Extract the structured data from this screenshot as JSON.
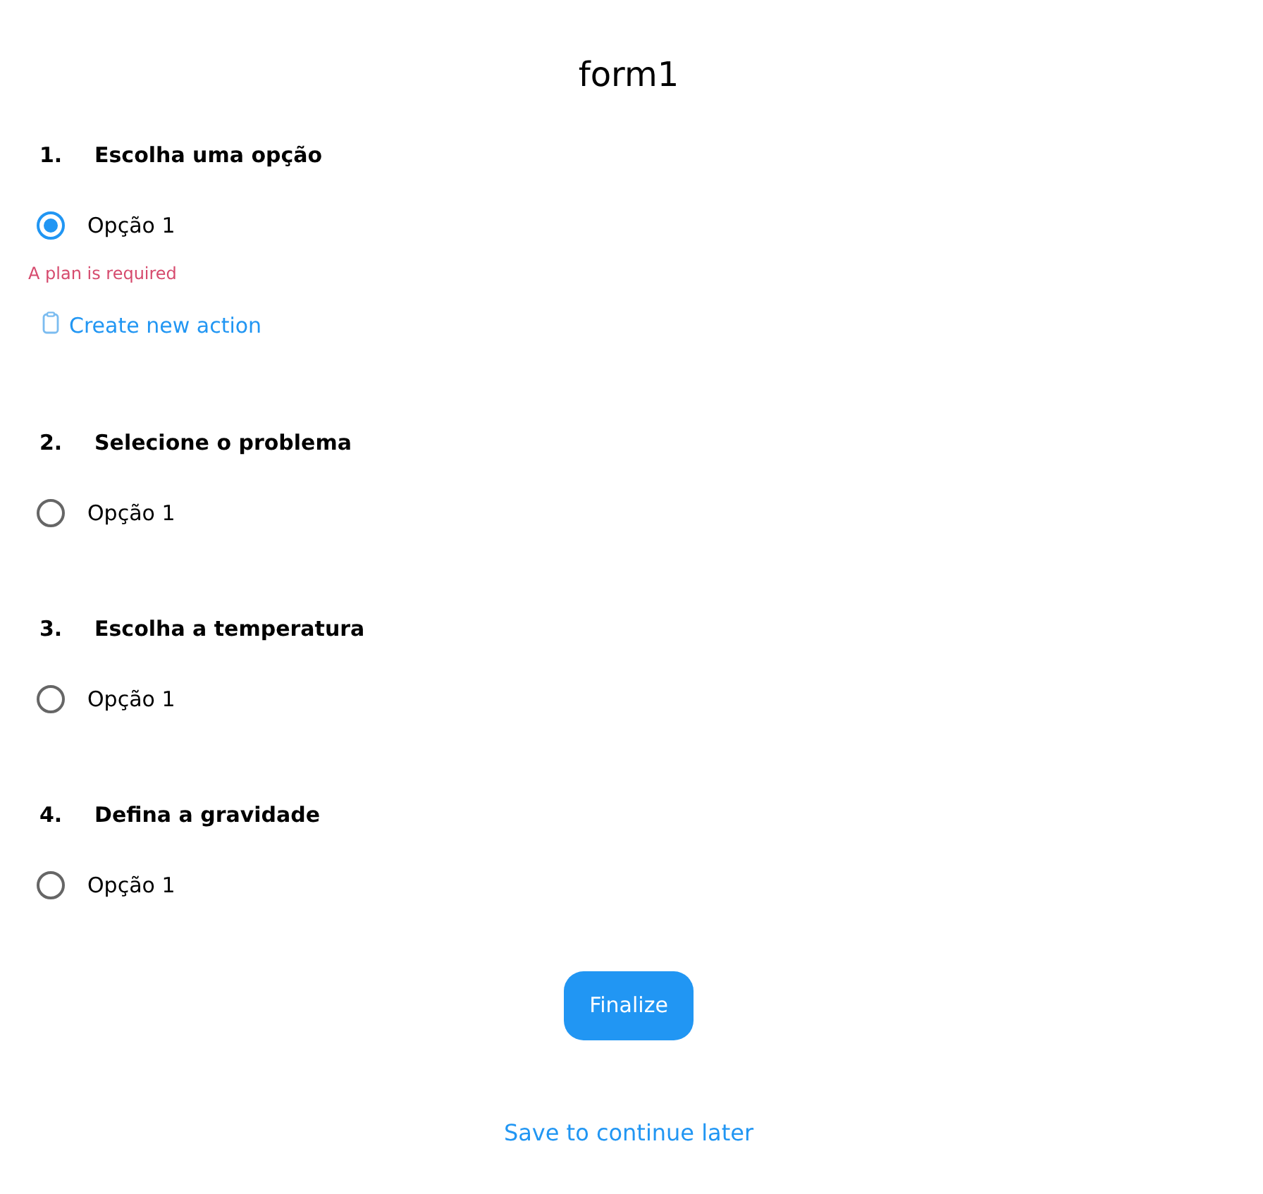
{
  "title": "form1",
  "questions": [
    {
      "number": "1.",
      "title": "Escolha uma opção",
      "options": [
        {
          "label": "Opção 1",
          "selected": true
        }
      ],
      "error": "A plan is required",
      "action": {
        "label": "Create new action"
      }
    },
    {
      "number": "2.",
      "title": "Selecione o problema",
      "options": [
        {
          "label": "Opção 1",
          "selected": false
        }
      ]
    },
    {
      "number": "3.",
      "title": "Escolha a temperatura",
      "options": [
        {
          "label": "Opção 1",
          "selected": false
        }
      ]
    },
    {
      "number": "4.",
      "title": "Defina a gravidade",
      "options": [
        {
          "label": "Opção 1",
          "selected": false
        }
      ]
    }
  ],
  "finalize_button": "Finalize",
  "save_link": "Save to continue later"
}
